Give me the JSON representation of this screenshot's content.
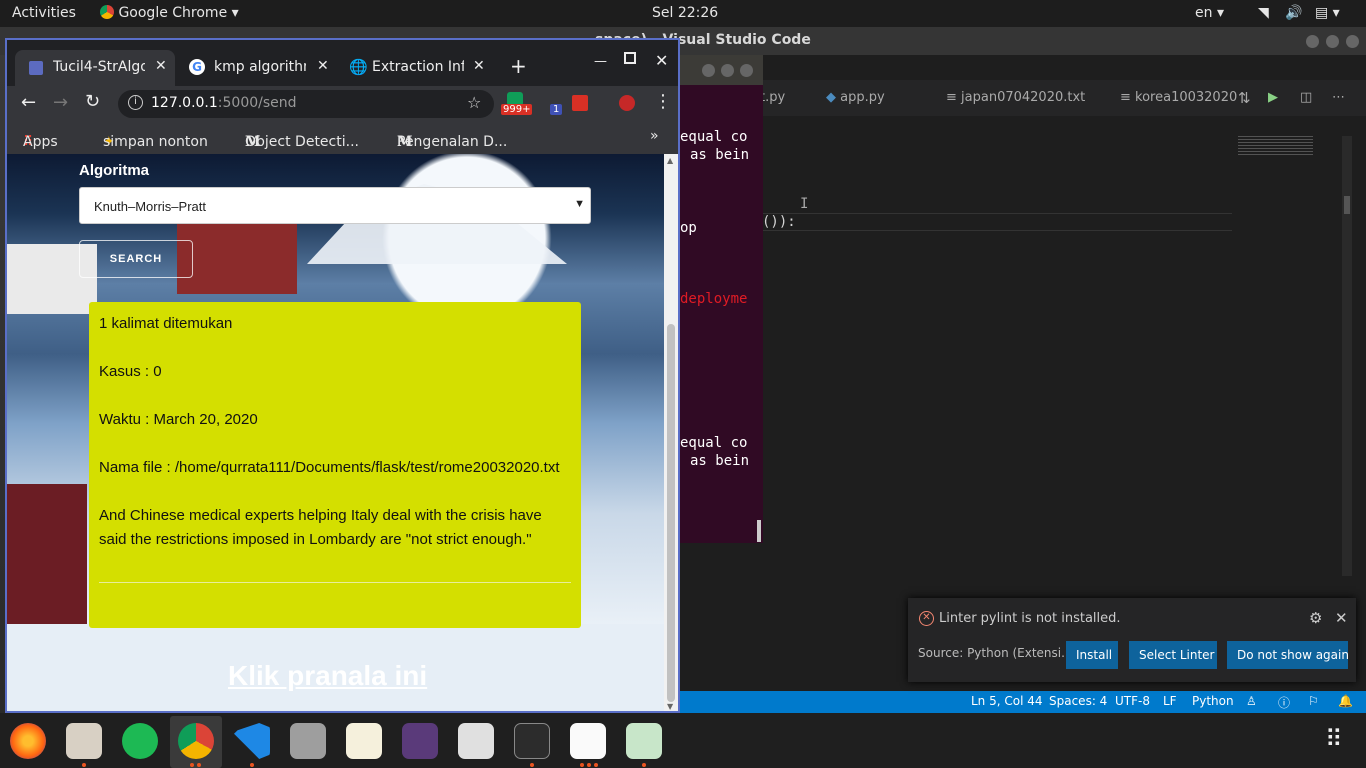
{
  "topbar": {
    "activities": "Activities",
    "app": "Google Chrome",
    "clock": "Sel 22:26",
    "lang": "en"
  },
  "vscode": {
    "title": "space) - Visual Studio Code",
    "tabs": [
      {
        "label": "t.py"
      },
      {
        "label": "app.py"
      },
      {
        "label": "japan07042020.txt"
      },
      {
        "label": "korea10032020"
      }
    ],
    "code_fragment": "()):",
    "status": {
      "pos": "Ln 5, Col 44",
      "spaces": "Spaces: 4",
      "enc": "UTF-8",
      "eol": "LF",
      "lang": "Python"
    },
    "notification": {
      "message": "Linter pylint is not installed.",
      "source": "Source: Python (Extensi...",
      "install": "Install",
      "select": "Select Linter",
      "dismiss": "Do not show again"
    }
  },
  "terminal": {
    "lines": [
      "equal co",
      "as bein",
      "op",
      "deployme",
      "equal co",
      "as bein"
    ]
  },
  "chrome": {
    "tabs": [
      {
        "title": "Tucil4-StrAlgo"
      },
      {
        "title": "kmp algorithm"
      },
      {
        "title": "Extraction Inf"
      }
    ],
    "url_host": "127.0.0.1",
    "url_path": ":5000/send",
    "badge1": "999+",
    "badge2": "1",
    "bookmarks": [
      "Apps",
      "simpan nonton",
      "Object Detecti...",
      "Pengenalan D..."
    ],
    "bm_more": "»"
  },
  "page": {
    "algo_label": "Algoritma",
    "algo_selected": "Knuth–Morris–Pratt",
    "search": "SEARCH",
    "result": {
      "count": "1 kalimat ditemukan",
      "kasus": "Kasus : 0",
      "waktu": "Waktu : March 20, 2020",
      "file": "Nama file : /home/qurrata111/Documents/flask/test/rome20032020.txt",
      "sentence": "And Chinese medical experts helping Italy deal with the crisis have said the restrictions imposed in Lombardy are \"not strict enough.\""
    },
    "link": "Klik pranala ini"
  },
  "dock": [
    "firefox-icon",
    "files-icon",
    "spotify-icon",
    "chrome-icon",
    "vscode-icon",
    "camera-icon",
    "text-editor-icon",
    "book-icon",
    "video-editor-icon",
    "terminal-icon",
    "pdf-icon",
    "image-viewer-icon"
  ],
  "colors": {
    "accent": "#007acc",
    "result_bg": "#d4df00",
    "chrome_border": "#5a6fc8",
    "ubuntu_orange": "#e95420"
  }
}
